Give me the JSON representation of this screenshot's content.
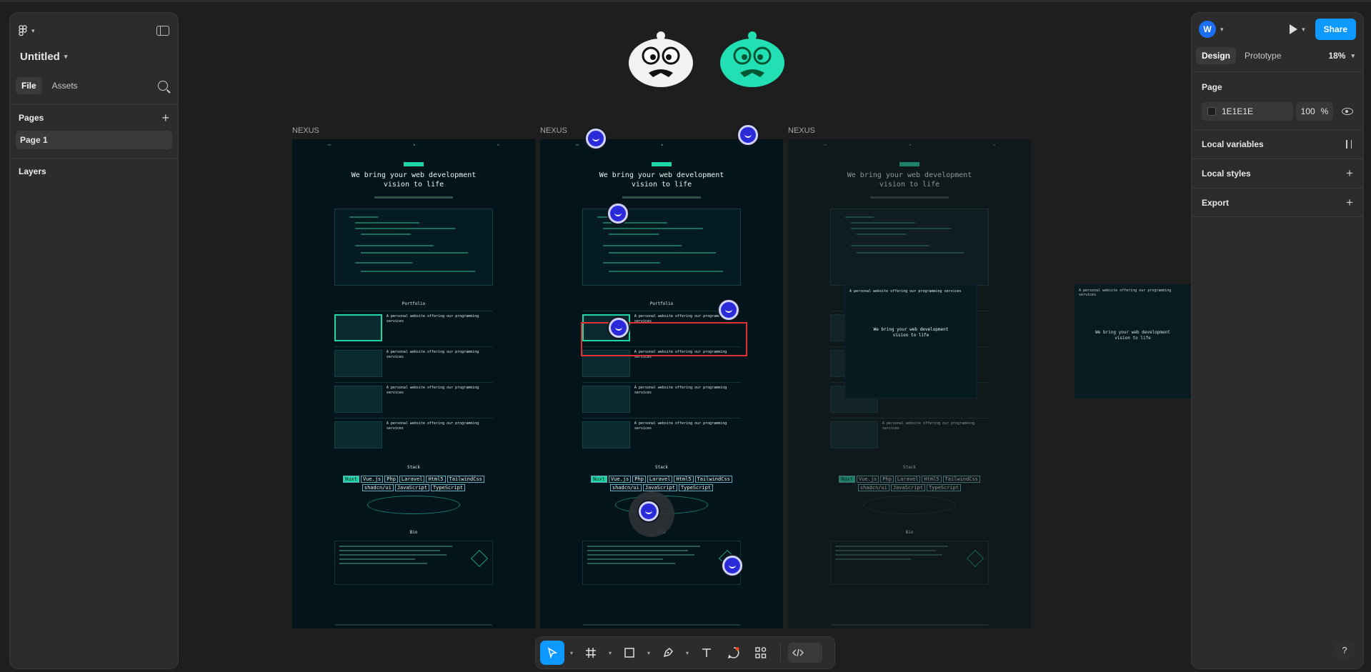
{
  "file": {
    "name": "Untitled"
  },
  "left_panel": {
    "tabs": [
      "File",
      "Assets"
    ],
    "pages_title": "Pages",
    "pages": [
      "Page 1"
    ],
    "layers_title": "Layers"
  },
  "right_panel": {
    "avatar_letter": "W",
    "share_label": "Share",
    "tabs": [
      "Design",
      "Prototype"
    ],
    "zoom": "18%",
    "page_section": "Page",
    "bg_color": "1E1E1E",
    "bg_opacity": "100",
    "percent": "%",
    "rows": [
      "Local variables",
      "Local styles",
      "Export"
    ]
  },
  "canvas": {
    "frame_labels": [
      "NEXUS",
      "NEXUS",
      "NEXUS"
    ],
    "hero_line1": "We bring your web development",
    "hero_line2": "vision to life",
    "portfolio_title": "Portfolio",
    "card_text": "A personal website offering our programming services",
    "stack_title": "Stack",
    "stack_row1": [
      "Nuxt",
      "Vue.js",
      "Php",
      "Laravel",
      "Html5"
    ],
    "stack_row2": [
      "TailwindCss",
      "shadcn/ui",
      "JavaScript",
      "TypeScript"
    ],
    "bio_title": "Bio"
  },
  "toolbar": {
    "help": "?"
  },
  "colors": {
    "accent": "#0d99ff",
    "frame_bg": "#03141a",
    "teal": "#1fd5a8",
    "selection": "#e03030"
  }
}
